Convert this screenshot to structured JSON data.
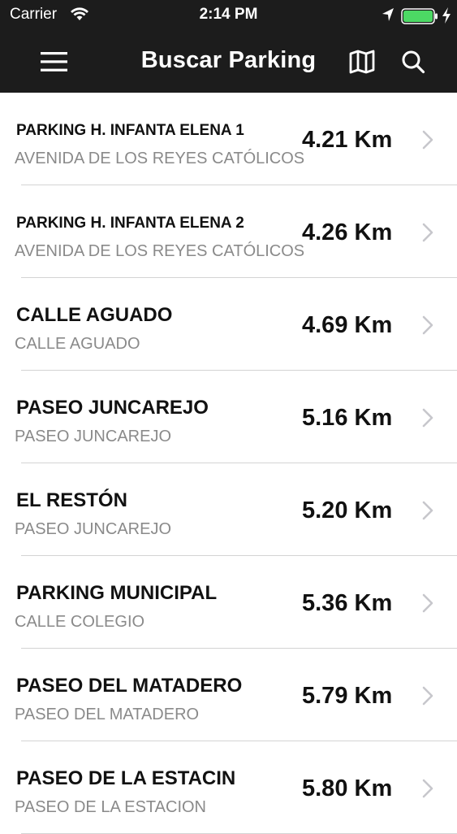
{
  "status_bar": {
    "carrier": "Carrier",
    "time": "2:14 PM"
  },
  "nav": {
    "title": "Buscar Parking",
    "icons": [
      "menu-icon",
      "map-icon",
      "search-icon"
    ]
  },
  "parkings": [
    {
      "name": "PARKING H. INFANTA ELENA 1",
      "address": "AVENIDA DE LOS REYES CATÓLICOS",
      "distance": "4.21 Km"
    },
    {
      "name": "PARKING H. INFANTA ELENA 2",
      "address": "AVENIDA DE LOS REYES CATÓLICOS",
      "distance": "4.26 Km"
    },
    {
      "name": "CALLE AGUADO",
      "address": "CALLE AGUADO",
      "distance": "4.69 Km"
    },
    {
      "name": "PASEO JUNCAREJO",
      "address": "PASEO JUNCAREJO",
      "distance": "5.16 Km"
    },
    {
      "name": "EL RESTÓN",
      "address": "PASEO JUNCAREJO",
      "distance": "5.20 Km"
    },
    {
      "name": "PARKING MUNICIPAL",
      "address": "CALLE COLEGIO",
      "distance": "5.36 Km"
    },
    {
      "name": "PASEO DEL MATADERO",
      "address": "PASEO DEL MATADERO",
      "distance": "5.79 Km"
    },
    {
      "name": "PASEO DE LA ESTACIN",
      "address": "PASEO DE LA ESTACION",
      "distance": "5.80 Km"
    }
  ],
  "colors": {
    "bar_background": "#1c1c1c",
    "battery": "#4cd964",
    "chevron": "#c7c7cc",
    "subtitle": "#8a8a8a"
  }
}
